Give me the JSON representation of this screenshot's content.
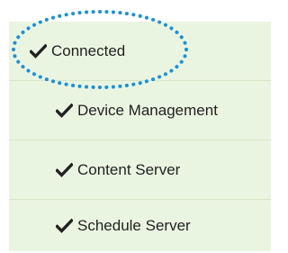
{
  "status_list": {
    "items": [
      {
        "label": "Connected",
        "icon": "checkmark-icon",
        "state": "ok"
      },
      {
        "label": "Device Management",
        "icon": "checkmark-icon",
        "state": "ok"
      },
      {
        "label": "Content Server",
        "icon": "checkmark-icon",
        "state": "ok"
      },
      {
        "label": "Schedule Server",
        "icon": "checkmark-icon",
        "state": "ok"
      }
    ]
  },
  "colors": {
    "panel_background": "#eaf5e1",
    "row_divider": "#d6e8c8",
    "text": "#222222",
    "highlight_ring": "#1e90d6"
  },
  "annotation": {
    "shape": "dotted-ellipse",
    "target": "Connected"
  }
}
